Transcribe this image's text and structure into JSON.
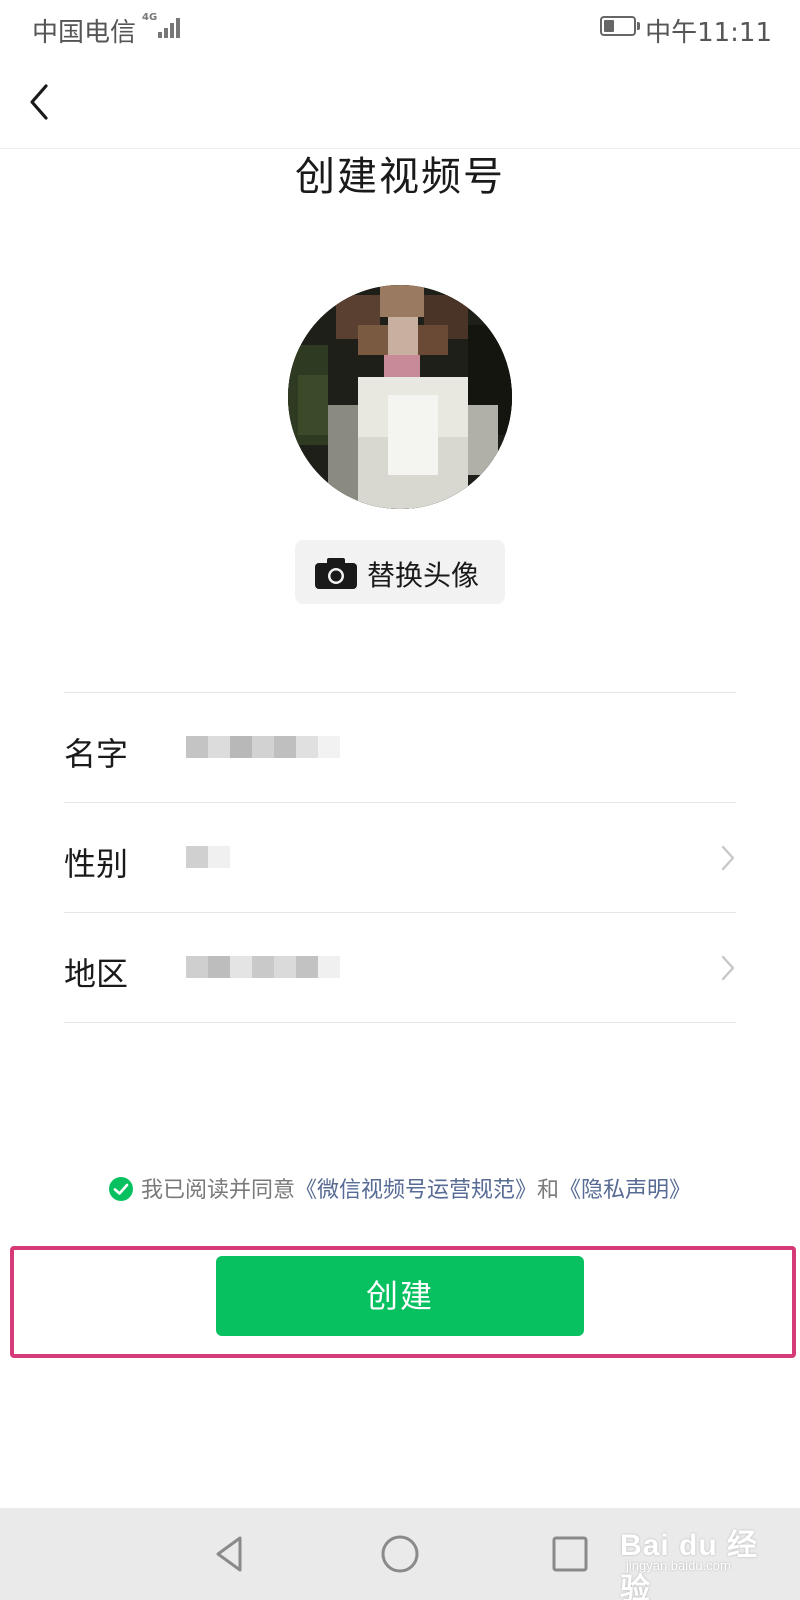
{
  "status_bar": {
    "carrier": "中国电信",
    "network": "4G",
    "time": "中午11:11"
  },
  "nav": {
    "back_icon": "chevron-left-icon"
  },
  "page": {
    "title": "创建视频号"
  },
  "avatar": {
    "replace_label": "替换头像",
    "replace_icon": "camera-icon"
  },
  "form": {
    "rows": [
      {
        "label": "名字"
      },
      {
        "label": "性别"
      },
      {
        "label": "地区"
      }
    ]
  },
  "agreement": {
    "prefix": "我已阅读并同意",
    "link1": "《微信视频号运营规范》",
    "and": "和",
    "link2": "《隐私声明》"
  },
  "actions": {
    "create_label": "创建"
  },
  "watermark": {
    "main": "Bai du 经验",
    "sub": "jingyan.baidu.com"
  },
  "colors": {
    "accent": "#07c160",
    "link": "#576b95",
    "highlight": "#d63a78"
  }
}
